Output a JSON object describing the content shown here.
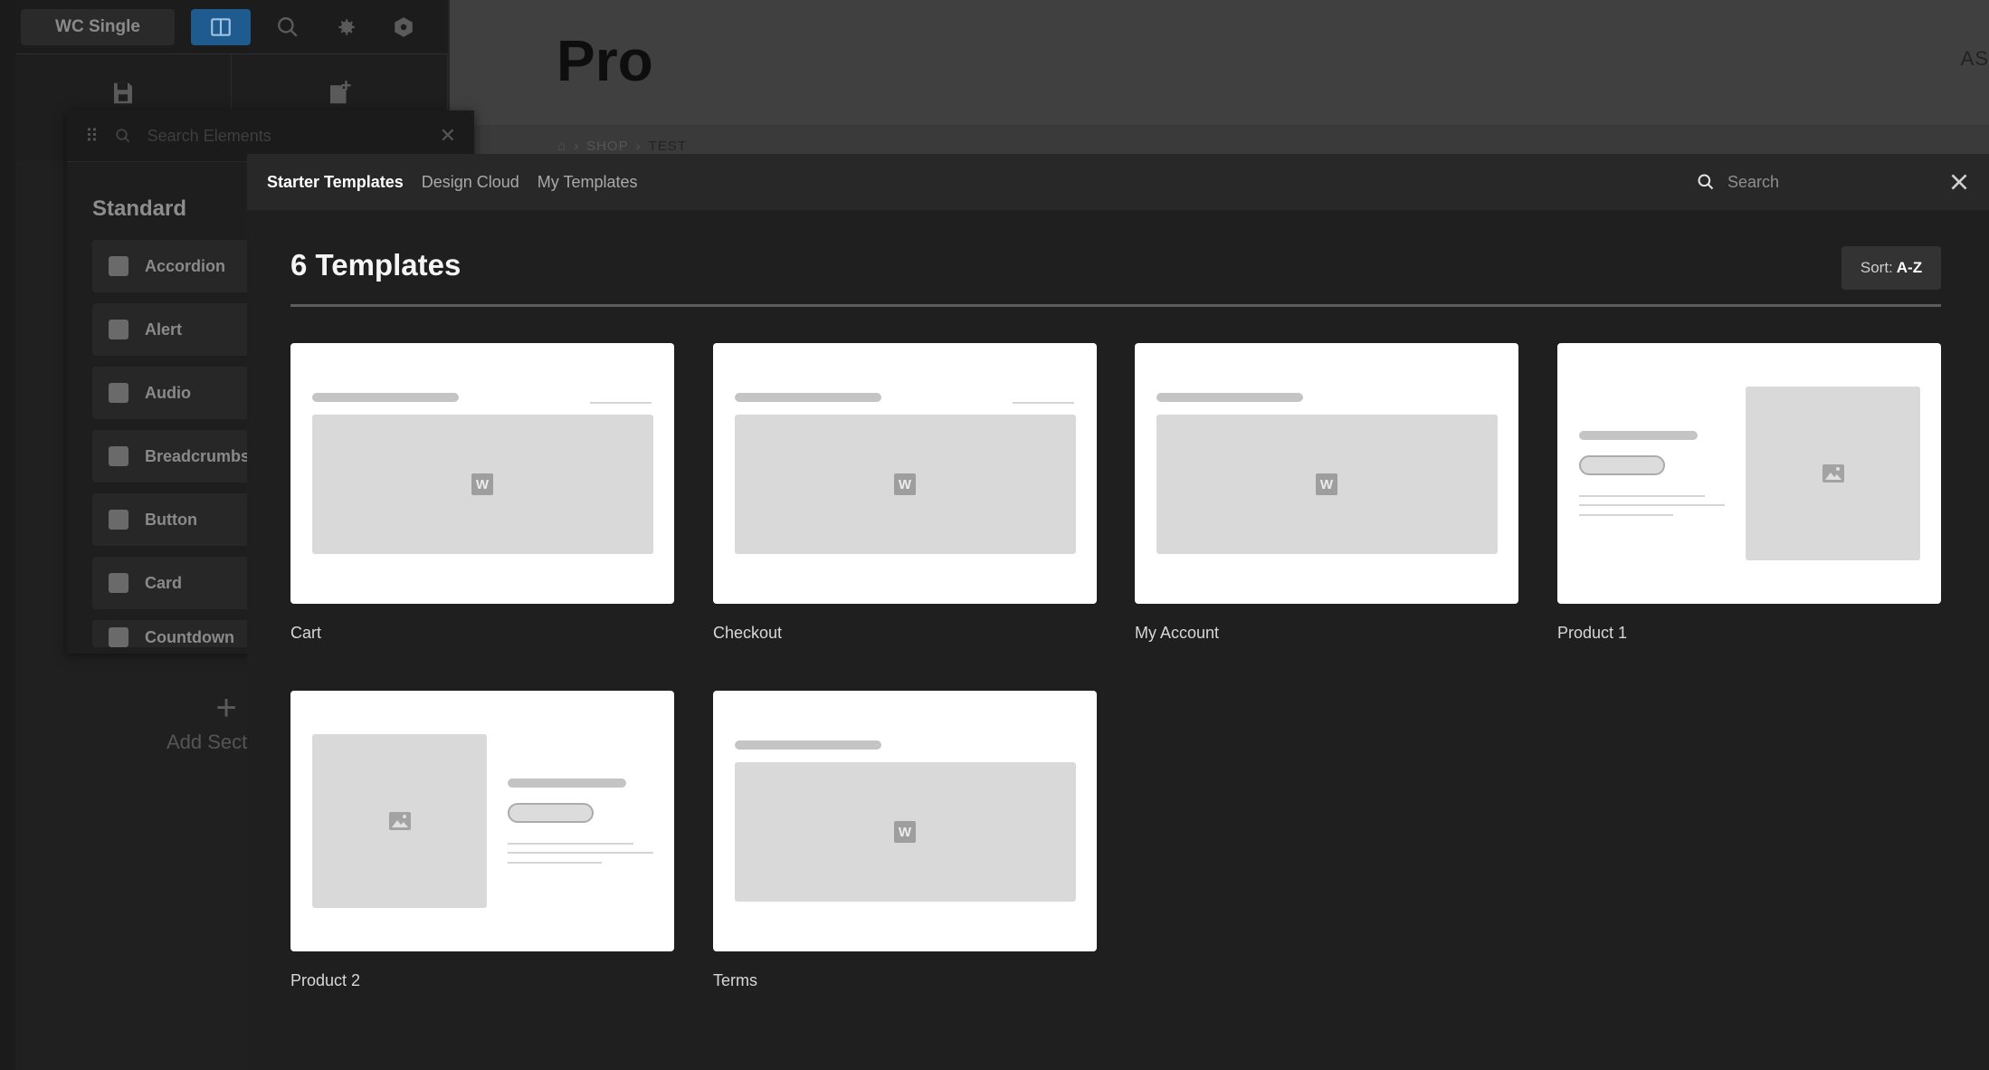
{
  "builder": {
    "page_selector": "WC Single",
    "canvas_title": "Pro",
    "canvas_right_text": "AS",
    "breadcrumb": [
      "SHOP",
      "TEST"
    ],
    "elements_search_placeholder": "Search Elements",
    "elements_heading": "Standard",
    "elements": [
      "Accordion",
      "Alert",
      "Audio",
      "Breadcrumbs",
      "Button",
      "Card",
      "Countdown"
    ],
    "add_section_label": "Add Secti"
  },
  "modal": {
    "tabs": [
      {
        "label": "Starter Templates",
        "active": true
      },
      {
        "label": "Design Cloud",
        "active": false
      },
      {
        "label": "My Templates",
        "active": false
      }
    ],
    "search_placeholder": "Search",
    "title": "6 Templates",
    "sort_prefix": "Sort:",
    "sort_value": "A-Z",
    "templates": [
      {
        "name": "Cart",
        "layout": "full-width"
      },
      {
        "name": "Checkout",
        "layout": "full-width"
      },
      {
        "name": "My Account",
        "layout": "full-width-no-line"
      },
      {
        "name": "Product 1",
        "layout": "text-left-image-right"
      },
      {
        "name": "Product 2",
        "layout": "image-left-text-right"
      },
      {
        "name": "Terms",
        "layout": "full-width-no-line"
      }
    ]
  },
  "colors": {
    "accent": "#1f5b8e",
    "modal_bg": "#1f1f1f",
    "modal_header_bg": "#282828",
    "card_bg": "#ffffff"
  }
}
